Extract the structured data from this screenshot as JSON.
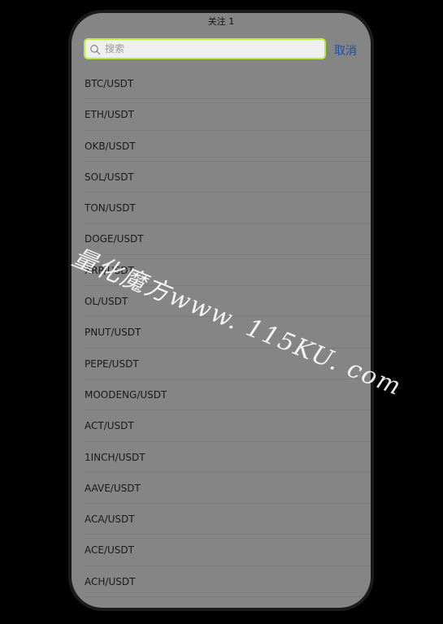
{
  "header": {
    "title": "关注 1"
  },
  "search": {
    "placeholder": "搜索",
    "value": "",
    "cancel_label": "取消"
  },
  "list": {
    "items": [
      "BTC/USDT",
      "ETH/USDT",
      "OKB/USDT",
      "SOL/USDT",
      "TON/USDT",
      "DOGE/USDT",
      "XRP/USDT",
      "OL/USDT",
      "PNUT/USDT",
      "PEPE/USDT",
      "MOODENG/USDT",
      "ACT/USDT",
      "1INCH/USDT",
      "AAVE/USDT",
      "ACA/USDT",
      "ACE/USDT",
      "ACH/USDT"
    ]
  },
  "watermark": {
    "text": "量化魔方www. 115KU. com"
  },
  "colors": {
    "background": "#000000",
    "screen": "#858585",
    "search_border": "#b6ef3f",
    "cancel": "#1e4f9e"
  }
}
